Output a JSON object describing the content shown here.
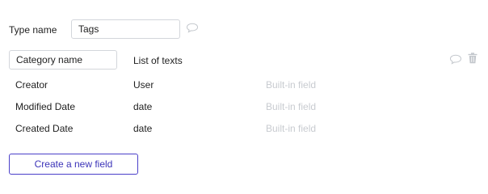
{
  "type_name": {
    "label": "Type name",
    "value": "Tags"
  },
  "fields": [
    {
      "name": "Category name",
      "type": "List of texts",
      "editable": true
    },
    {
      "name": "Creator",
      "type": "User",
      "note": "Built-in field"
    },
    {
      "name": "Modified Date",
      "type": "date",
      "note": "Built-in field"
    },
    {
      "name": "Created Date",
      "type": "date",
      "note": "Built-in field"
    }
  ],
  "create_button": {
    "label": "Create a new field"
  },
  "icons": {
    "comment": "comment-icon",
    "trash": "trash-icon"
  },
  "colors": {
    "accent": "#3b33b8",
    "muted": "#c8cbd0",
    "border": "#d3d6db"
  }
}
